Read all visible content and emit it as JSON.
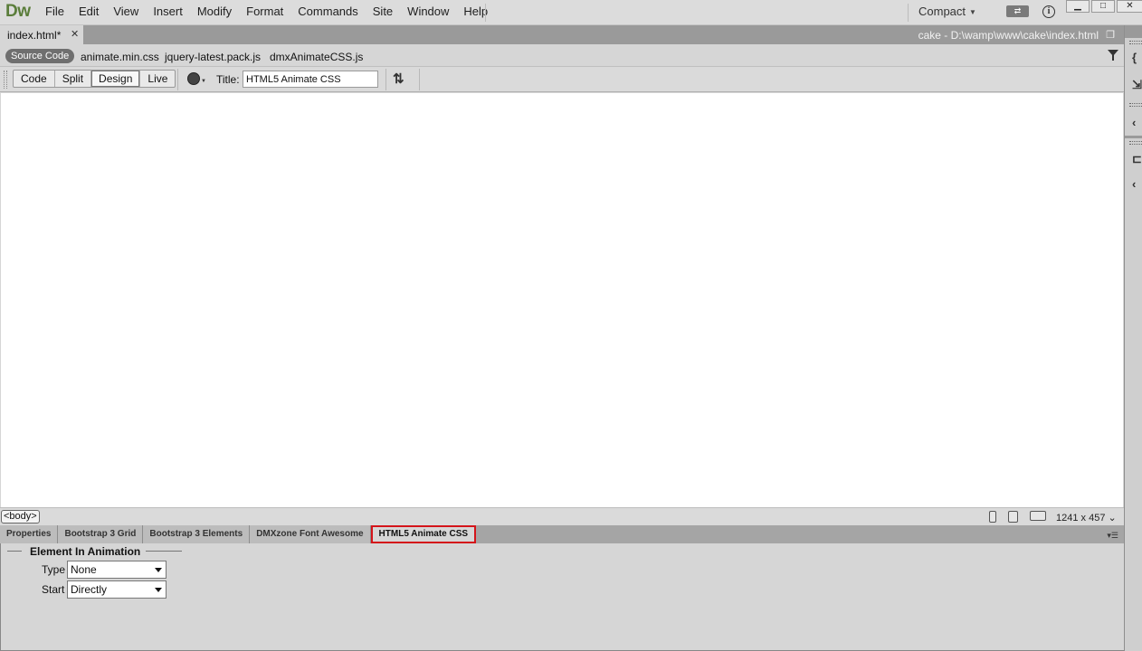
{
  "app": {
    "logo": "Dw"
  },
  "menu": [
    "File",
    "Edit",
    "View",
    "Insert",
    "Modify",
    "Format",
    "Commands",
    "Site",
    "Window",
    "Help"
  ],
  "workspace": {
    "layout": "Compact"
  },
  "document_tab": {
    "label": "index.html*",
    "path": "cake - D:\\wamp\\www\\cake\\index.html"
  },
  "related_files": {
    "source": "Source Code",
    "files": [
      "animate.min.css",
      "jquery-latest.pack.js",
      "dmxAnimateCSS.js"
    ]
  },
  "doc_toolbar": {
    "views": [
      "Code",
      "Split",
      "Design",
      "Live"
    ],
    "active_view": "Design",
    "title_label": "Title:",
    "title_value": "HTML5 Animate CSS"
  },
  "status": {
    "tag": "<body>",
    "dimensions": "1241 x 457 ⌄"
  },
  "panel_tabs": [
    "Properties",
    "Bootstrap 3 Grid",
    "Bootstrap 3 Elements",
    "DMXzone Font Awesome",
    "HTML5 Animate CSS"
  ],
  "active_panel_tab": "HTML5 Animate CSS",
  "panel": {
    "section_title": "Element In Animation",
    "type_label": "Type",
    "type_value": "None",
    "start_label": "Start",
    "start_value": "Directly"
  },
  "colors": {
    "highlight": "#d4141a",
    "logo": "#5a7d3a"
  }
}
